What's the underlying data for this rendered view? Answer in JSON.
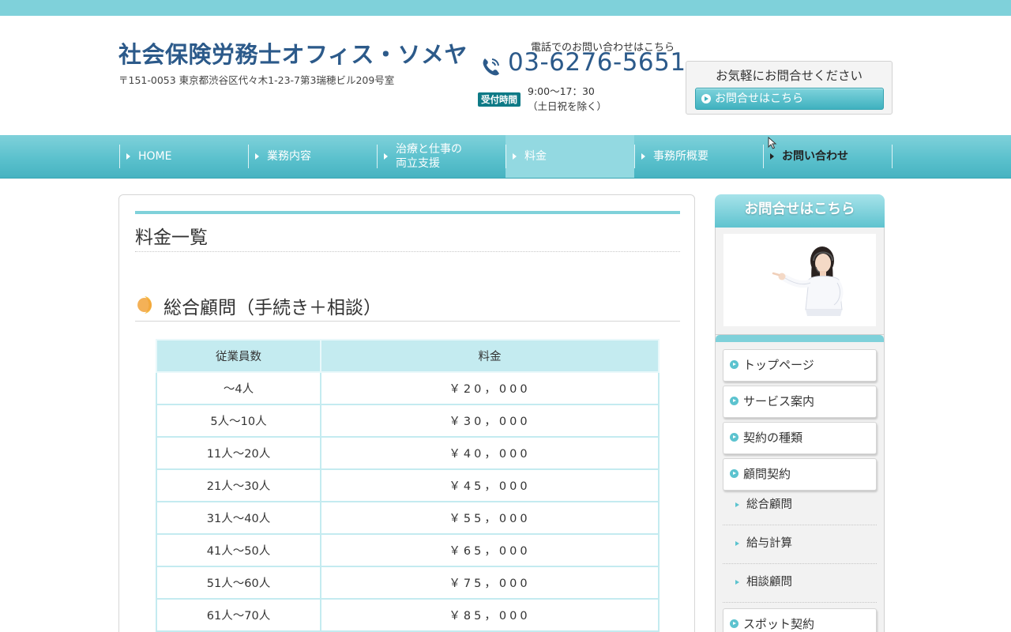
{
  "header": {
    "site_title": "社会保険労務士オフィス・ソメヤ",
    "address": "〒151-0053 東京都渋谷区代々木1-23-7第3瑞穂ビル209号室",
    "tel_caption": "電話でのお問い合わせはこちら",
    "phone_number": "03-6276-5651",
    "hours_badge": "受付時間",
    "hours": "9:00〜17：30",
    "hours_note": "（土日祝を除く）",
    "contact_box_title": "お気軽にお問合せください",
    "contact_box_button": "お問合せはこちら"
  },
  "nav": {
    "items": [
      {
        "label": "HOME"
      },
      {
        "label": "業務内容"
      },
      {
        "label_line1": "治療と仕事の",
        "label_line2": "両立支援"
      },
      {
        "label": "料金"
      },
      {
        "label": "事務所概要"
      },
      {
        "label": "お問い合わせ"
      }
    ],
    "active_index": 3
  },
  "main": {
    "page_title": "料金一覧",
    "section_title": "総合顧問（手続き＋相談）",
    "table": {
      "headers": [
        "従業員数",
        "料金"
      ],
      "rows": [
        [
          "〜4人",
          "￥20，000"
        ],
        [
          "5人〜10人",
          "￥30，000"
        ],
        [
          "11人〜20人",
          "￥40，000"
        ],
        [
          "21人〜30人",
          "￥45，000"
        ],
        [
          "31人〜40人",
          "￥55，000"
        ],
        [
          "41人〜50人",
          "￥65，000"
        ],
        [
          "51人〜60人",
          "￥75，000"
        ],
        [
          "61人〜70人",
          "￥85，000"
        ]
      ]
    }
  },
  "sidebar": {
    "contact_heading": "お問合せはこちら",
    "menu": [
      {
        "label": "トップページ"
      },
      {
        "label": "サービス案内"
      },
      {
        "label": "契約の種類"
      },
      {
        "label": "顧問契約"
      }
    ],
    "submenu": [
      {
        "label": "総合顧問"
      },
      {
        "label": "給与計算"
      },
      {
        "label": "相談顧問"
      }
    ],
    "menu_after": [
      {
        "label": "スポット契約"
      }
    ]
  },
  "colors": {
    "accent": "#7fd1da",
    "nav_bottom": "#46b3c1",
    "title_blue": "#2c5a8a",
    "badge": "#0e7a86"
  }
}
